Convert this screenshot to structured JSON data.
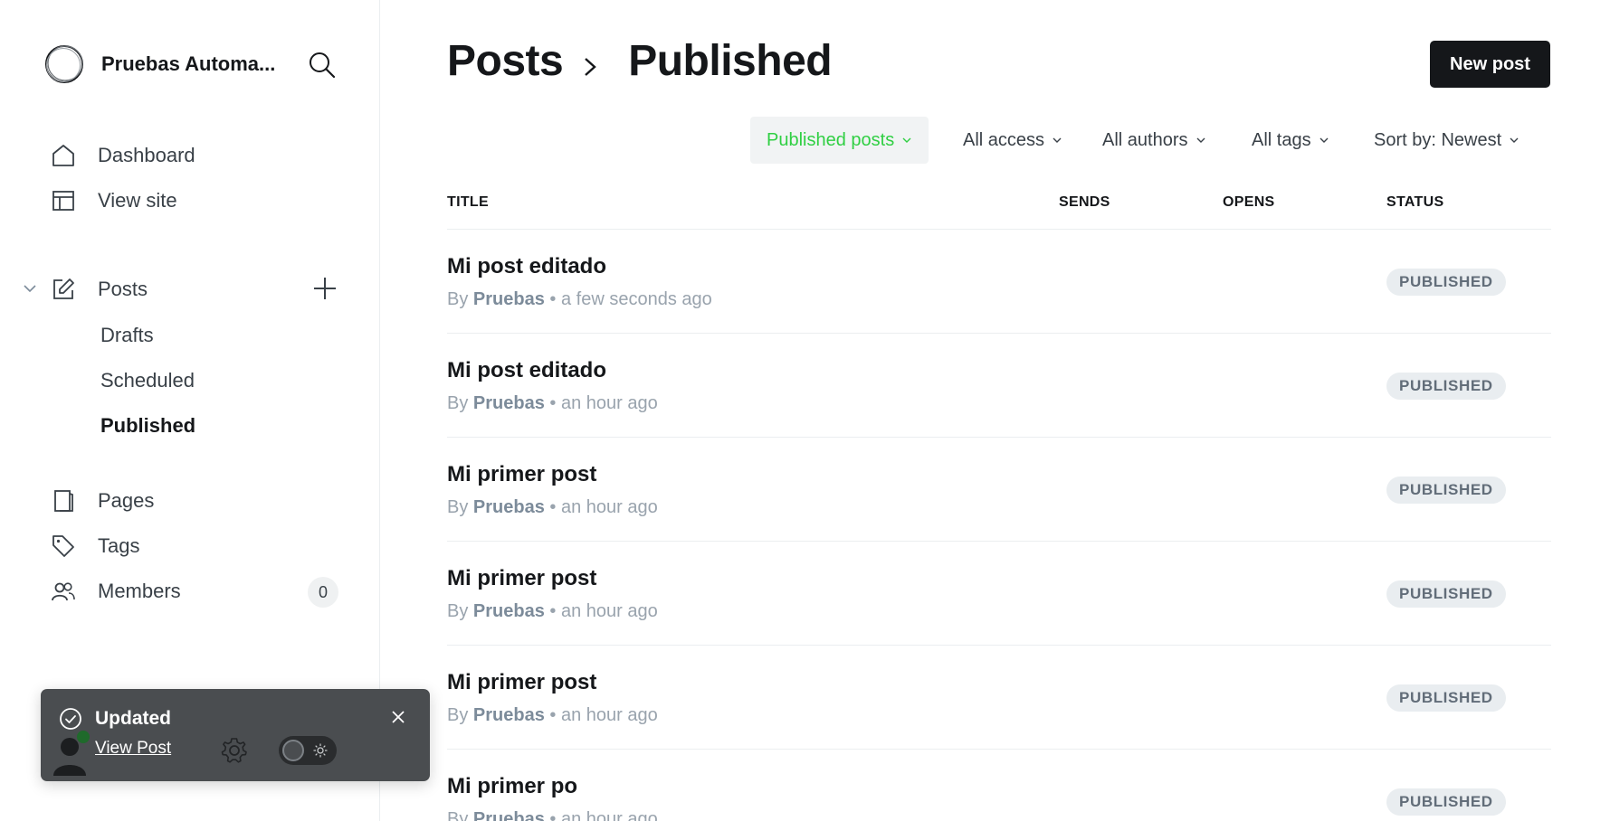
{
  "sidebar": {
    "site_name": "Pruebas Automa...",
    "nav": {
      "dashboard": "Dashboard",
      "view_site": "View site",
      "posts": "Posts",
      "pages": "Pages",
      "tags": "Tags",
      "members": "Members"
    },
    "posts_sub": {
      "drafts": "Drafts",
      "scheduled": "Scheduled",
      "published": "Published"
    },
    "members_count": "0"
  },
  "toast": {
    "title": "Updated",
    "link": "View Post"
  },
  "header": {
    "breadcrumb_parent": "Posts",
    "breadcrumb_current": "Published",
    "new_post_label": "New post"
  },
  "filters": {
    "type": "Published posts",
    "access": "All access",
    "authors": "All authors",
    "tags": "All tags",
    "sort": "Sort by: Newest"
  },
  "columns": {
    "title": "TITLE",
    "sends": "SENDS",
    "opens": "OPENS",
    "status": "STATUS"
  },
  "posts": [
    {
      "title": "Mi post editado",
      "by": "By",
      "author": "Pruebas",
      "time": "• a few seconds ago",
      "status": "PUBLISHED"
    },
    {
      "title": "Mi post editado",
      "by": "By",
      "author": "Pruebas",
      "time": "• an hour ago",
      "status": "PUBLISHED"
    },
    {
      "title": "Mi primer post",
      "by": "By",
      "author": "Pruebas",
      "time": "• an hour ago",
      "status": "PUBLISHED"
    },
    {
      "title": "Mi primer post",
      "by": "By",
      "author": "Pruebas",
      "time": "• an hour ago",
      "status": "PUBLISHED"
    },
    {
      "title": "Mi primer post",
      "by": "By",
      "author": "Pruebas",
      "time": "• an hour ago",
      "status": "PUBLISHED"
    },
    {
      "title": "Mi primer po",
      "by": "By",
      "author": "Pruebas",
      "time": "• an hour ago",
      "status": "PUBLISHED"
    }
  ],
  "colors": {
    "accent_green": "#30cf43",
    "button_dark": "#15171a",
    "toast_bg": "#4a4d50"
  }
}
